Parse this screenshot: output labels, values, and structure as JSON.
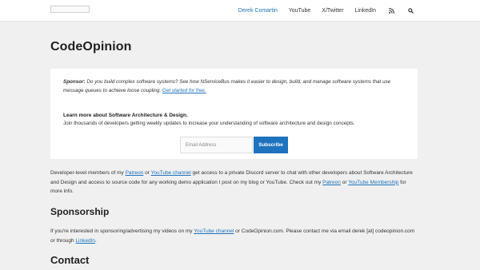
{
  "header": {
    "logo_alt": "",
    "nav": [
      {
        "label": "Derek Comartin",
        "active": true
      },
      {
        "label": "YouTube"
      },
      {
        "label": "X/Twitter"
      },
      {
        "label": "LinkedIn"
      }
    ],
    "icons": [
      "rss-icon",
      "search-icon"
    ]
  },
  "page": {
    "title": "CodeOpinion",
    "sponsor": {
      "label": "Sponsor:",
      "text": " Do you build complex software systems? See how NServiceBus makes it easier to design, build, and manage software systems that use message queues to achieve loose coupling.",
      "link": "Get started for free."
    },
    "newsletter": {
      "title": "Learn more about Software Architecture & Design.",
      "subtitle": "Join thousands of developers getting weekly updates to increase your understanding of software architecture and design concepts.",
      "email_placeholder": "Email Address",
      "subscribe_label": "Subscribe"
    },
    "members": {
      "t1": "Developer-level members of my ",
      "patreon": "Patreon",
      "t2": " or ",
      "yt_channel": "YouTube channel",
      "t3": " get access to a private Discord server to chat with other developers about Software Architecture and Design and access to source code for any working demo application I post on my blog or YouTube. Check out my ",
      "patreon2": "Patreon",
      "t4": " or ",
      "yt_membership": "YouTube Membership",
      "t5": " for more info."
    },
    "sponsorship_heading": "Sponsorship",
    "sponsorship": {
      "t1": "If you're interested in sponsoring/advertising my videos on my ",
      "yt_channel": "YouTube channel",
      "t2": " or CodeOpinion.com. Please contact me via email derek [at] codeopinion.com or through ",
      "linkedin": "LinkedIn",
      "t3": "."
    },
    "contact_heading": "Contact"
  }
}
